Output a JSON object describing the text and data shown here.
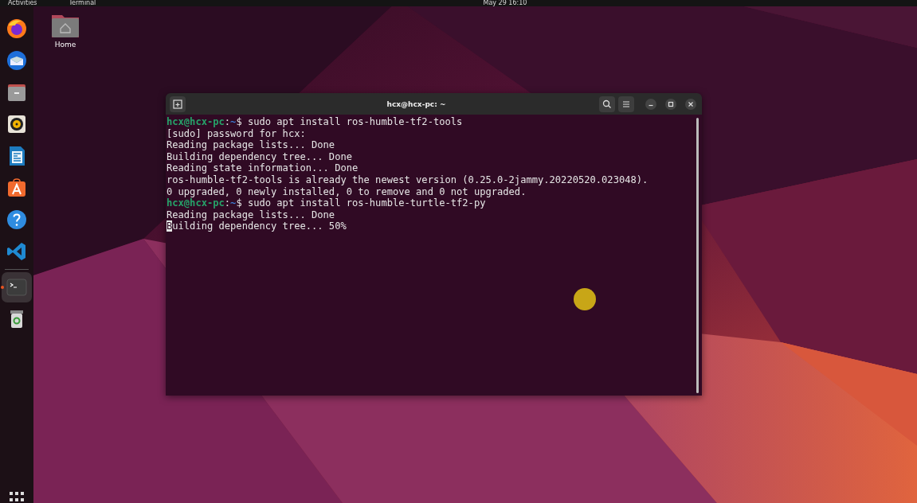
{
  "top_bar": {
    "activities": "Activities",
    "app_name": "Terminal",
    "clock": "May 29  16:10"
  },
  "dock": {
    "items": [
      {
        "kind": "firefox",
        "running": false
      },
      {
        "kind": "thunderbird",
        "running": false
      },
      {
        "kind": "files",
        "running": false
      },
      {
        "kind": "rhythmbox",
        "running": false
      },
      {
        "kind": "writer",
        "running": false
      },
      {
        "kind": "appcenter",
        "running": false
      },
      {
        "kind": "help",
        "running": false
      },
      {
        "kind": "vscode",
        "running": false
      },
      {
        "kind": "separator"
      },
      {
        "kind": "terminal",
        "running": true
      },
      {
        "kind": "trash",
        "running": false
      }
    ]
  },
  "desktop_icons": [
    {
      "label": "Home"
    }
  ],
  "terminal": {
    "title": "hcx@hcx-pc: ~",
    "lines": [
      {
        "kind": "prompt",
        "user_host": "hcx@hcx-pc",
        "sep": ":",
        "path": "~",
        "symbol": "$",
        "command": "sudo apt install ros-humble-tf2-tools"
      },
      {
        "kind": "output",
        "text": "[sudo] password for hcx:"
      },
      {
        "kind": "output",
        "text": "Reading package lists... Done"
      },
      {
        "kind": "output",
        "text": "Building dependency tree... Done"
      },
      {
        "kind": "output",
        "text": "Reading state information... Done"
      },
      {
        "kind": "output",
        "text": "ros-humble-tf2-tools is already the newest version (0.25.0-2jammy.20220520.023048)."
      },
      {
        "kind": "output",
        "text": "0 upgraded, 0 newly installed, 0 to remove and 0 not upgraded."
      },
      {
        "kind": "prompt",
        "user_host": "hcx@hcx-pc",
        "sep": ":",
        "path": "~",
        "symbol": "$",
        "command": "sudo apt install ros-humble-turtle-tf2-py"
      },
      {
        "kind": "output",
        "text": "Reading package lists... Done"
      },
      {
        "kind": "output",
        "text": "Building dependency tree... 50%",
        "cursor": true
      }
    ]
  }
}
